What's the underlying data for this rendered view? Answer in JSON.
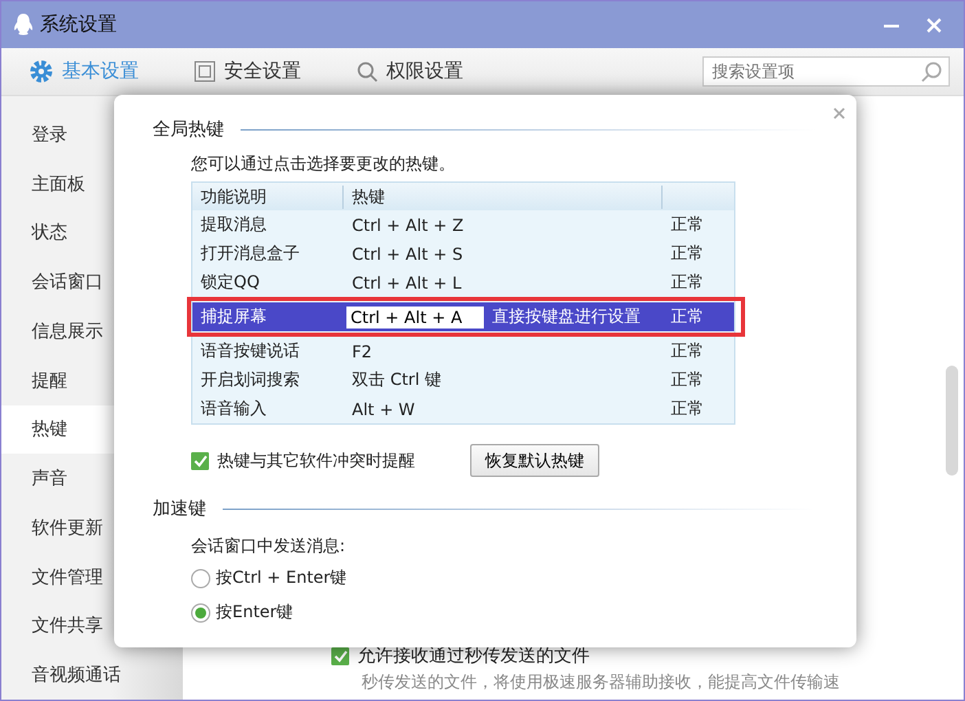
{
  "window": {
    "title": "系统设置"
  },
  "tabs": [
    {
      "label": "基本设置",
      "selected": true
    },
    {
      "label": "安全设置",
      "selected": false
    },
    {
      "label": "权限设置",
      "selected": false
    }
  ],
  "search": {
    "placeholder": "搜索设置项"
  },
  "sidebar": {
    "items": [
      {
        "label": "登录",
        "selected": false
      },
      {
        "label": "主面板",
        "selected": false
      },
      {
        "label": "状态",
        "selected": false
      },
      {
        "label": "会话窗口",
        "selected": false
      },
      {
        "label": "信息展示",
        "selected": false
      },
      {
        "label": "提醒",
        "selected": false
      },
      {
        "label": "热键",
        "selected": true
      },
      {
        "label": "声音",
        "selected": false
      },
      {
        "label": "软件更新",
        "selected": false
      },
      {
        "label": "文件管理",
        "selected": false
      },
      {
        "label": "文件共享",
        "selected": false
      },
      {
        "label": "音视频通话",
        "selected": false
      }
    ]
  },
  "background_content": {
    "checkbox": {
      "label": "允许接收通过秒传发送的文件",
      "checked": true
    },
    "description": "秒传发送的文件，将使用极速服务器辅助接收，能提高文件传输速"
  },
  "dialog": {
    "global_hotkeys": {
      "title": "全局热键",
      "hint": "您可以通过点击选择要更改的热键。",
      "columns": [
        "功能说明",
        "热键"
      ],
      "rows": [
        {
          "function": "提取消息",
          "hotkey": "Ctrl + Alt + Z",
          "status": "正常",
          "selected": false
        },
        {
          "function": "打开消息盒子",
          "hotkey": "Ctrl + Alt + S",
          "status": "正常",
          "selected": false
        },
        {
          "function": "锁定QQ",
          "hotkey": "Ctrl + Alt + L",
          "status": "正常",
          "selected": false
        },
        {
          "function": "捕捉屏幕",
          "hotkey": "Ctrl + Alt + A",
          "prompt": "直接按键盘进行设置",
          "status": "正常",
          "selected": true
        },
        {
          "function": "语音按键说话",
          "hotkey": "F2",
          "status": "正常",
          "selected": false
        },
        {
          "function": "开启划词搜索",
          "hotkey": "双击 Ctrl 键",
          "status": "正常",
          "selected": false
        },
        {
          "function": "语音输入",
          "hotkey": "Alt + W",
          "status": "正常",
          "selected": false
        }
      ],
      "conflict_alert": {
        "label": "热键与其它软件冲突时提醒",
        "checked": true
      },
      "restore_button": "恢复默认热键"
    },
    "accelerator": {
      "title": "加速键",
      "label": "会话窗口中发送消息:",
      "options": [
        {
          "label": "按Ctrl + Enter键",
          "selected": false
        },
        {
          "label": "按Enter键",
          "selected": true
        }
      ]
    }
  }
}
